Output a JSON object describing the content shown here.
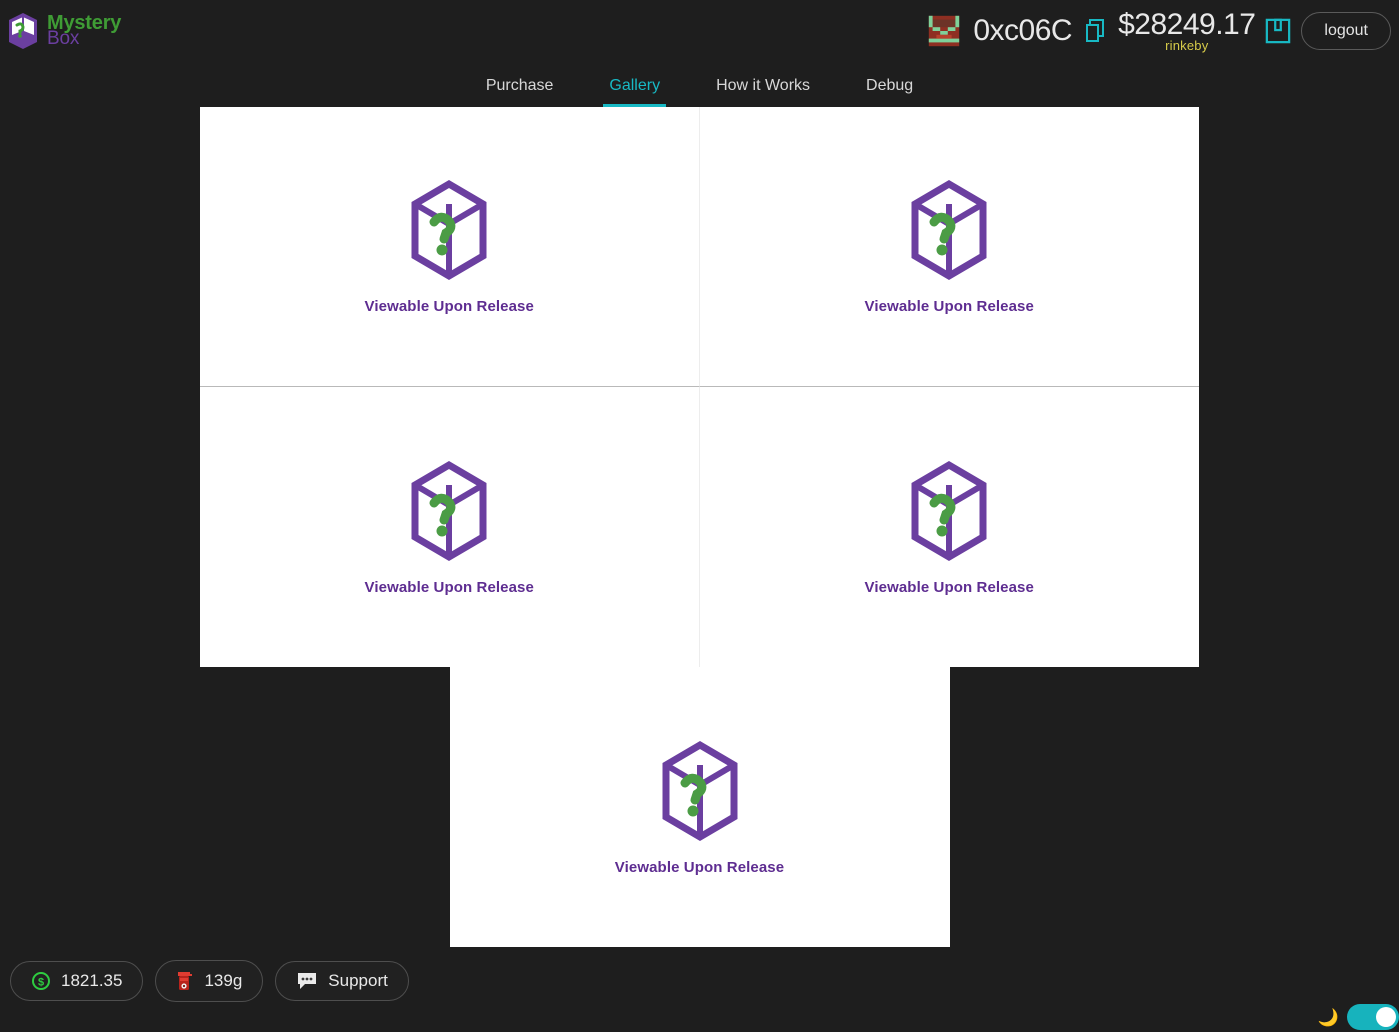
{
  "brand": {
    "name_line1": "Mystery",
    "name_line2": "Box",
    "logo_icon": "mystery-box-icon",
    "green": "#3f9c35",
    "purple": "#6b3fa0"
  },
  "header": {
    "avatar_icon": "pixel-avatar-icon",
    "wallet_address": "0xc06C",
    "copy_icon": "copy-icon",
    "balance": "$28249.17",
    "network": "rinkeby",
    "save_icon": "save-icon",
    "logout_label": "logout",
    "accent_teal": "#18b9c4",
    "network_color": "#d6cb49"
  },
  "nav": {
    "tabs": [
      {
        "label": "Purchase",
        "active": false
      },
      {
        "label": "Gallery",
        "active": true
      },
      {
        "label": "How it Works",
        "active": false
      },
      {
        "label": "Debug",
        "active": false
      }
    ]
  },
  "gallery": {
    "items": [
      {
        "label": "Viewable Upon Release",
        "icon": "mystery-box-icon"
      },
      {
        "label": "Viewable Upon Release",
        "icon": "mystery-box-icon"
      },
      {
        "label": "Viewable Upon Release",
        "icon": "mystery-box-icon"
      },
      {
        "label": "Viewable Upon Release",
        "icon": "mystery-box-icon"
      },
      {
        "label": "Viewable Upon Release",
        "icon": "mystery-box-icon"
      }
    ],
    "label_color": "#5e2d91"
  },
  "footer": {
    "balance_pill": {
      "icon": "dollar-coin-icon",
      "label": "1821.35"
    },
    "gas_pill": {
      "icon": "gas-pump-icon",
      "label": "139g"
    },
    "support_pill": {
      "icon": "chat-bubble-icon",
      "label": "Support"
    }
  },
  "theme": {
    "moon_icon": "moon-icon",
    "toggle_on": true,
    "toggle_color": "#17b3bd"
  }
}
